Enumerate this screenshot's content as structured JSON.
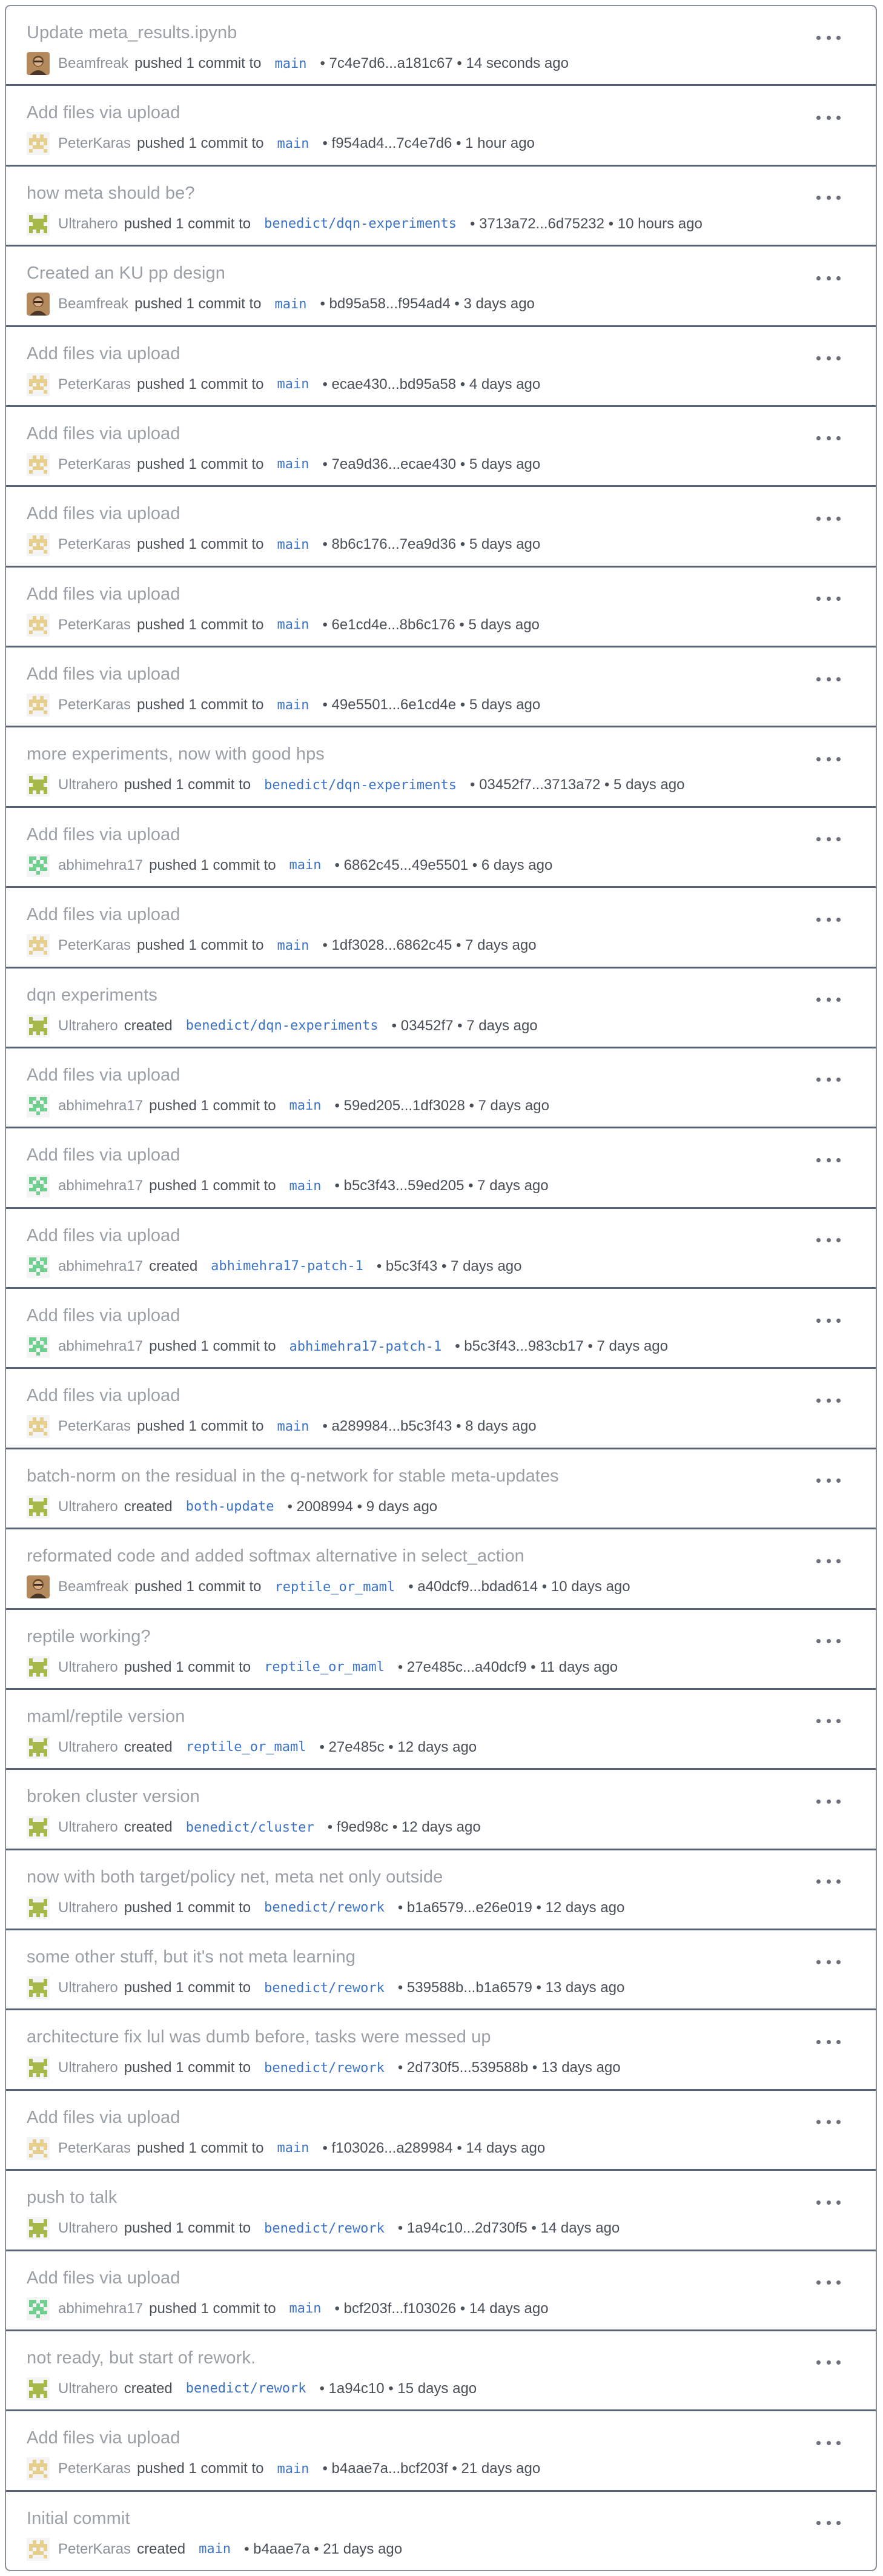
{
  "colors": {
    "title": "#9aa0a6",
    "branch": "#3c73c6",
    "divider": "#5a6275"
  },
  "menu_icon": "more-horizontal-icon",
  "events": [
    {
      "title": "Update meta_results.ipynb",
      "user": "Beamfreak",
      "avatar": "photo-avatar",
      "action": "pushed 1 commit to",
      "branch": "main",
      "commit": "• 7c4e7d6...a181c67 • 14 seconds ago"
    },
    {
      "title": "Add files via upload",
      "user": "PeterKaras",
      "avatar": "yellow-identicon",
      "action": "pushed 1 commit to",
      "branch": "main",
      "commit": "• f954ad4...7c4e7d6 • 1 hour ago"
    },
    {
      "title": "how meta should be?",
      "user": "Ultrahero",
      "avatar": "olive-identicon",
      "action": "pushed 1 commit to",
      "branch": "benedict/dqn-experiments",
      "commit": "• 3713a72...6d75232 • 10 hours ago"
    },
    {
      "title": "Created an KU pp design",
      "user": "Beamfreak",
      "avatar": "photo-avatar",
      "action": "pushed 1 commit to",
      "branch": "main",
      "commit": "• bd95a58...f954ad4 • 3 days ago"
    },
    {
      "title": "Add files via upload",
      "user": "PeterKaras",
      "avatar": "yellow-identicon",
      "action": "pushed 1 commit to",
      "branch": "main",
      "commit": "• ecae430...bd95a58 • 4 days ago"
    },
    {
      "title": "Add files via upload",
      "user": "PeterKaras",
      "avatar": "yellow-identicon",
      "action": "pushed 1 commit to",
      "branch": "main",
      "commit": "• 7ea9d36...ecae430 • 5 days ago"
    },
    {
      "title": "Add files via upload",
      "user": "PeterKaras",
      "avatar": "yellow-identicon",
      "action": "pushed 1 commit to",
      "branch": "main",
      "commit": "• 8b6c176...7ea9d36 • 5 days ago"
    },
    {
      "title": "Add files via upload",
      "user": "PeterKaras",
      "avatar": "yellow-identicon",
      "action": "pushed 1 commit to",
      "branch": "main",
      "commit": "• 6e1cd4e...8b6c176 • 5 days ago"
    },
    {
      "title": "Add files via upload",
      "user": "PeterKaras",
      "avatar": "yellow-identicon",
      "action": "pushed 1 commit to",
      "branch": "main",
      "commit": "• 49e5501...6e1cd4e • 5 days ago"
    },
    {
      "title": "more experiments, now with good hps",
      "user": "Ultrahero",
      "avatar": "olive-identicon",
      "action": "pushed 1 commit to",
      "branch": "benedict/dqn-experiments",
      "commit": "• 03452f7...3713a72 • 5 days ago"
    },
    {
      "title": "Add files via upload",
      "user": "abhimehra17",
      "avatar": "green-identicon",
      "action": "pushed 1 commit to",
      "branch": "main",
      "commit": "• 6862c45...49e5501 • 6 days ago"
    },
    {
      "title": "Add files via upload",
      "user": "PeterKaras",
      "avatar": "yellow-identicon",
      "action": "pushed 1 commit to",
      "branch": "main",
      "commit": "• 1df3028...6862c45 • 7 days ago"
    },
    {
      "title": "dqn experiments",
      "user": "Ultrahero",
      "avatar": "olive-identicon",
      "action": "created",
      "branch": "benedict/dqn-experiments",
      "commit": "• 03452f7 • 7 days ago"
    },
    {
      "title": "Add files via upload",
      "user": "abhimehra17",
      "avatar": "green-identicon",
      "action": "pushed 1 commit to",
      "branch": "main",
      "commit": "• 59ed205...1df3028 • 7 days ago"
    },
    {
      "title": "Add files via upload",
      "user": "abhimehra17",
      "avatar": "green-identicon",
      "action": "pushed 1 commit to",
      "branch": "main",
      "commit": "• b5c3f43...59ed205 • 7 days ago"
    },
    {
      "title": "Add files via upload",
      "user": "abhimehra17",
      "avatar": "green-identicon",
      "action": "created",
      "branch": "abhimehra17-patch-1",
      "commit": "• b5c3f43 • 7 days ago"
    },
    {
      "title": "Add files via upload",
      "user": "abhimehra17",
      "avatar": "green-identicon",
      "action": "pushed 1 commit to",
      "branch": "abhimehra17-patch-1",
      "commit": "• b5c3f43...983cb17 • 7 days ago"
    },
    {
      "title": "Add files via upload",
      "user": "PeterKaras",
      "avatar": "yellow-identicon",
      "action": "pushed 1 commit to",
      "branch": "main",
      "commit": "• a289984...b5c3f43 • 8 days ago"
    },
    {
      "title": "batch-norm on the residual in the q-network for stable meta-updates",
      "user": "Ultrahero",
      "avatar": "olive-identicon",
      "action": "created",
      "branch": "both-update",
      "commit": "• 2008994 • 9 days ago"
    },
    {
      "title": "reformated code and added softmax alternative in select_action",
      "user": "Beamfreak",
      "avatar": "photo-avatar",
      "action": "pushed 1 commit to",
      "branch": "reptile_or_maml",
      "commit": "• a40dcf9...bdad614 • 10 days ago"
    },
    {
      "title": "reptile working?",
      "user": "Ultrahero",
      "avatar": "olive-identicon",
      "action": "pushed 1 commit to",
      "branch": "reptile_or_maml",
      "commit": "• 27e485c...a40dcf9 • 11 days ago"
    },
    {
      "title": "maml/reptile version",
      "user": "Ultrahero",
      "avatar": "olive-identicon",
      "action": "created",
      "branch": "reptile_or_maml",
      "commit": "• 27e485c • 12 days ago"
    },
    {
      "title": "broken cluster version",
      "user": "Ultrahero",
      "avatar": "olive-identicon",
      "action": "created",
      "branch": "benedict/cluster",
      "commit": "• f9ed98c • 12 days ago"
    },
    {
      "title": "now with both target/policy net, meta net only outside",
      "user": "Ultrahero",
      "avatar": "olive-identicon",
      "action": "pushed 1 commit to",
      "branch": "benedict/rework",
      "commit": "• b1a6579...e26e019 • 12 days ago"
    },
    {
      "title": "some other stuff, but it's not meta learning",
      "user": "Ultrahero",
      "avatar": "olive-identicon",
      "action": "pushed 1 commit to",
      "branch": "benedict/rework",
      "commit": "• 539588b...b1a6579 • 13 days ago"
    },
    {
      "title": "architecture fix lul was dumb before, tasks were messed up",
      "user": "Ultrahero",
      "avatar": "olive-identicon",
      "action": "pushed 1 commit to",
      "branch": "benedict/rework",
      "commit": "• 2d730f5...539588b • 13 days ago"
    },
    {
      "title": "Add files via upload",
      "user": "PeterKaras",
      "avatar": "yellow-identicon",
      "action": "pushed 1 commit to",
      "branch": "main",
      "commit": "• f103026...a289984 • 14 days ago"
    },
    {
      "title": "push to talk",
      "user": "Ultrahero",
      "avatar": "olive-identicon",
      "action": "pushed 1 commit to",
      "branch": "benedict/rework",
      "commit": "• 1a94c10...2d730f5 • 14 days ago"
    },
    {
      "title": "Add files via upload",
      "user": "abhimehra17",
      "avatar": "green-identicon",
      "action": "pushed 1 commit to",
      "branch": "main",
      "commit": "• bcf203f...f103026 • 14 days ago"
    },
    {
      "title": "not ready, but start of rework.",
      "user": "Ultrahero",
      "avatar": "olive-identicon",
      "action": "created",
      "branch": "benedict/rework",
      "commit": "• 1a94c10 • 15 days ago"
    },
    {
      "title": "Add files via upload",
      "user": "PeterKaras",
      "avatar": "yellow-identicon",
      "action": "pushed 1 commit to",
      "branch": "main",
      "commit": "• b4aae7a...bcf203f • 21 days ago"
    },
    {
      "title": "Initial commit",
      "user": "PeterKaras",
      "avatar": "yellow-identicon",
      "action": "created",
      "branch": "main",
      "commit": "• b4aae7a • 21 days ago"
    }
  ]
}
